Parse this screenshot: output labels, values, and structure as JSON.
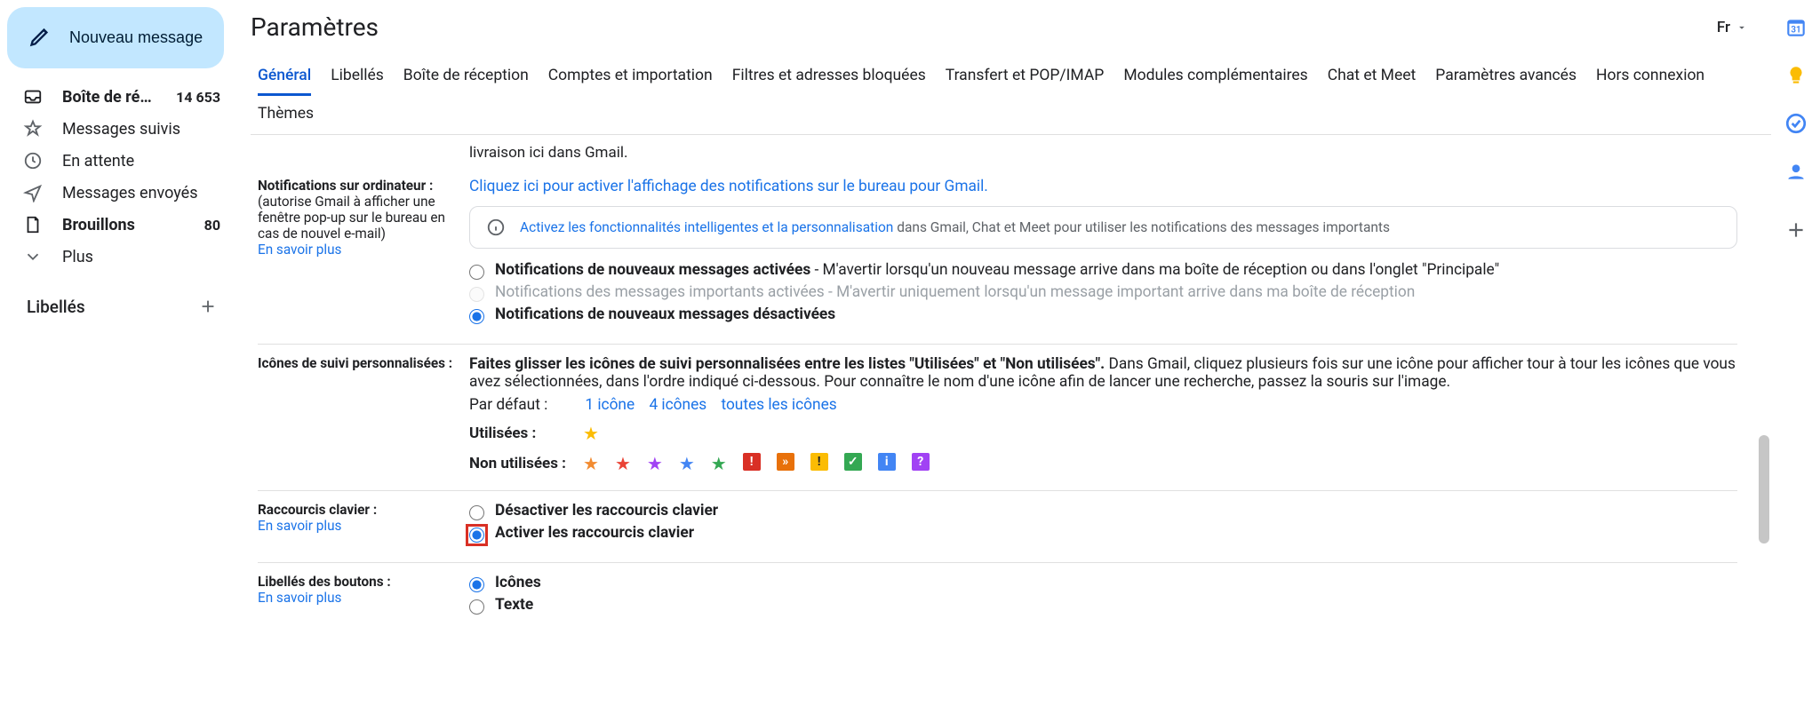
{
  "sidebar": {
    "compose": "Nouveau message",
    "folders": [
      {
        "label": "Boîte de récept…",
        "count": "14 653",
        "bold": true,
        "icon": "inbox"
      },
      {
        "label": "Messages suivis",
        "count": "",
        "bold": false,
        "icon": "star"
      },
      {
        "label": "En attente",
        "count": "",
        "bold": false,
        "icon": "clock"
      },
      {
        "label": "Messages envoyés",
        "count": "",
        "bold": false,
        "icon": "send"
      },
      {
        "label": "Brouillons",
        "count": "80",
        "bold": true,
        "icon": "file"
      },
      {
        "label": "Plus",
        "count": "",
        "bold": false,
        "icon": "chevron"
      }
    ],
    "labels_title": "Libellés"
  },
  "header": {
    "title": "Paramètres",
    "language": "Fr"
  },
  "tabs": [
    "Général",
    "Libellés",
    "Boîte de réception",
    "Comptes et importation",
    "Filtres et adresses bloquées",
    "Transfert et POP/IMAP",
    "Modules complémentaires",
    "Chat et Meet",
    "Paramètres avancés",
    "Hors connexion",
    "Thèmes"
  ],
  "truncated_top": "livraison ici dans Gmail.",
  "notif": {
    "heading": "Notifications sur ordinateur :",
    "sub": "(autorise Gmail à afficher une fenêtre pop-up sur le bureau en cas de nouvel e-mail)",
    "learn": "En savoir plus",
    "link": "Cliquez ici pour activer l'affichage des notifications sur le bureau pour Gmail.",
    "info_link": "Activez les fonctionnalités intelligentes et la personnalisation",
    "info_rest": " dans Gmail, Chat et Meet pour utiliser les notifications des messages importants",
    "opt1_bold": "Notifications de nouveaux messages activées",
    "opt1_rest": " - M'avertir lorsqu'un nouveau message arrive dans ma boîte de réception ou dans l'onglet \"Principale\"",
    "opt2": "Notifications des messages importants activées - M'avertir uniquement lorsqu'un message important arrive dans ma boîte de réception",
    "opt3": "Notifications de nouveaux messages désactivées"
  },
  "stars": {
    "heading": "Icônes de suivi personnalisées :",
    "intro_bold": "Faites glisser les icônes de suivi personnalisées entre les listes \"Utilisées\" et \"Non utilisées\".",
    "intro_rest": " Dans Gmail, cliquez plusieurs fois sur une icône pour afficher tour à tour les icônes que vous avez sélectionnées, dans l'ordre indiqué ci-dessous. Pour connaître le nom d'une icône afin de lancer une recherche, passez la souris sur l'image.",
    "default_label": "Par défaut :",
    "default_opts": [
      "1 icône",
      "4 icônes",
      "toutes les icônes"
    ],
    "used_label": "Utilisées :",
    "unused_label": "Non utilisées :"
  },
  "shortcuts": {
    "heading": "Raccourcis clavier :",
    "learn": "En savoir plus",
    "opt1": "Désactiver les raccourcis clavier",
    "opt2": "Activer les raccourcis clavier"
  },
  "buttons": {
    "heading": "Libellés des boutons :",
    "learn": "En savoir plus",
    "opt1": "Icônes",
    "opt2": "Texte"
  }
}
